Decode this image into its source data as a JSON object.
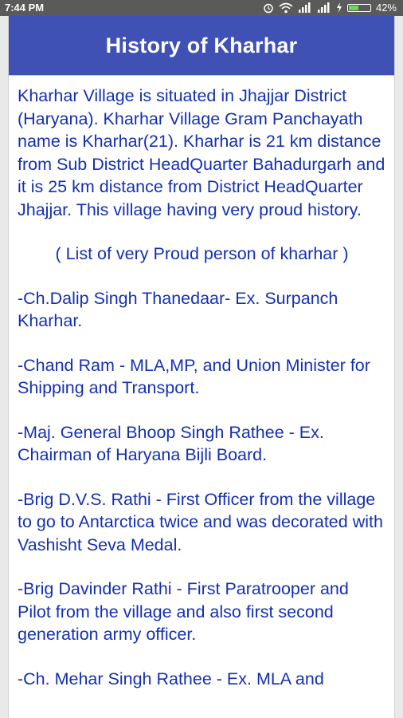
{
  "status_bar": {
    "time": "7:44 PM",
    "battery_percent": "42%",
    "battery_level": 0.42
  },
  "header": {
    "title": "History of Kharhar"
  },
  "content": {
    "intro": "Kharhar Village is situated in Jhajjar District (Haryana). Kharhar Village Gram Panchayath name is Kharhar(21). Kharhar is 21 km distance from Sub District HeadQuarter Bahadurgarh and it is 25 km distance from District HeadQuarter Jhajjar. This village having very proud history.",
    "list_heading": "( List of very Proud person of kharhar )",
    "persons": [
      "-Ch.Dalip Singh Thanedaar- Ex. Surpanch Kharhar.",
      "-Chand Ram - MLA,MP, and Union Minister for Shipping and Transport.",
      "-Maj. General Bhoop Singh Rathee - Ex. Chairman of Haryana Bijli Board.",
      "-Brig D.V.S. Rathi - First Officer from the village to go to Antarctica twice and was decorated with Vashisht Seva Medal.",
      "-Brig Davinder Rathi - First Paratrooper and Pilot from the village and also first second generation army officer.",
      "-Ch. Mehar Singh Rathee - Ex. MLA and"
    ]
  }
}
